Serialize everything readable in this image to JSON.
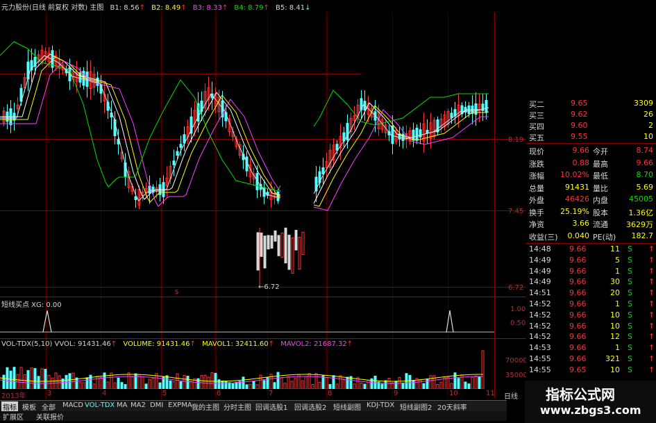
{
  "header": {
    "title": "元力股份(日线 前复权 对数) 主图",
    "b1": "B1: 8.56",
    "b2": "B2: 8.49",
    "b3": "B3: 8.33",
    "b4": "B4: 8.79",
    "b5": "B5: 8.41"
  },
  "main_chart": {
    "y_labels": [
      "8.19",
      "7.45",
      "6.72"
    ],
    "low_marker": "←6.72",
    "s_marker": "S",
    "date_label": "2013年",
    "month_labels": [
      "3",
      "4",
      "5",
      "6",
      "7",
      "8",
      "9",
      "10",
      "11"
    ]
  },
  "xg_panel": {
    "title": "短线买点 XG: 0.00",
    "y_labels": [
      "1.00",
      "0.50"
    ]
  },
  "vol_panel": {
    "name": "VOL-TDX(5,10)",
    "vvol": "VVOL: 91431.46",
    "volume": "VOLUME: 91431.46",
    "mavol1": "MAVOL1: 32411.60",
    "mavol2": "MAVOL2: 21687.32",
    "y_labels": [
      "70000",
      "35000"
    ]
  },
  "quote": {
    "bids": [
      {
        "name": "买二",
        "price": "9.65",
        "vol": "3309"
      },
      {
        "name": "买三",
        "price": "9.62",
        "vol": "26"
      },
      {
        "name": "买四",
        "price": "9.60",
        "vol": "2"
      },
      {
        "name": "买五",
        "price": "9.55",
        "vol": "10"
      }
    ],
    "stats": [
      {
        "l1": "现价",
        "v1": "9.66",
        "l2": "今开",
        "v2": "8.74"
      },
      {
        "l1": "涨跌",
        "v1": "0.88",
        "l2": "最高",
        "v2": "9.66"
      },
      {
        "l1": "涨幅",
        "v1": "10.02%",
        "l2": "最低",
        "v2": "8.70"
      },
      {
        "l1": "总量",
        "v1": "91431",
        "l2": "量比",
        "v2": "5.69"
      },
      {
        "l1": "外盘",
        "v1": "46426",
        "l2": "内盘",
        "v2": "45005"
      },
      {
        "l1": "换手",
        "v1": "25.19%",
        "l2": "股本",
        "v2": "1.36亿"
      },
      {
        "l1": "净资",
        "v1": "3.66",
        "l2": "流通",
        "v2": "3629万"
      },
      {
        "l1": "收益(三)",
        "v1": "0.040",
        "l2": "PE(动)",
        "v2": "182.7"
      }
    ],
    "ticks": [
      {
        "time": "14:48",
        "price": "9.66",
        "vol": "11",
        "flag": "S"
      },
      {
        "time": "14:49",
        "price": "9.66",
        "vol": "5",
        "flag": "S"
      },
      {
        "time": "14:49",
        "price": "9.66",
        "vol": "1",
        "flag": "S"
      },
      {
        "time": "14:49",
        "price": "9.66",
        "vol": "30",
        "flag": "S"
      },
      {
        "time": "14:51",
        "price": "9.66",
        "vol": "20",
        "flag": "S"
      },
      {
        "time": "14:52",
        "price": "9.66",
        "vol": "1",
        "flag": "S"
      },
      {
        "time": "14:52",
        "price": "9.66",
        "vol": "10",
        "flag": "S"
      },
      {
        "time": "14:52",
        "price": "9.66",
        "vol": "10",
        "flag": "S"
      },
      {
        "time": "14:52",
        "price": "9.66",
        "vol": "12",
        "flag": "S"
      },
      {
        "time": "14:53",
        "price": "9.66",
        "vol": "1",
        "flag": "S"
      },
      {
        "time": "14:55",
        "price": "9.66",
        "vol": "321",
        "flag": "S"
      },
      {
        "time": "14:55",
        "price": "9.65",
        "vol": "10",
        "flag": "S"
      }
    ]
  },
  "tabs": [
    "指标",
    "模板",
    "全部",
    "MACD",
    "VOL-TDX",
    "MA",
    "MA2",
    "DMI",
    "EXPMA",
    "我的主图",
    "分时主图",
    "回调选股1",
    "回调选股2",
    "短线副图",
    "KDJ-TDX",
    "短线副图2",
    "20天斜率"
  ],
  "tabs2": [
    "扩展区",
    "关联报价"
  ],
  "side_tab": "日线",
  "watermark": {
    "name": "指标公式网",
    "url": "www.zbgs3.com"
  },
  "colors": {
    "up": "#ff3232",
    "down": "#54ffff",
    "grid": "#8a0000",
    "accent_yellow": "#ffff00",
    "green": "#00e000"
  }
}
